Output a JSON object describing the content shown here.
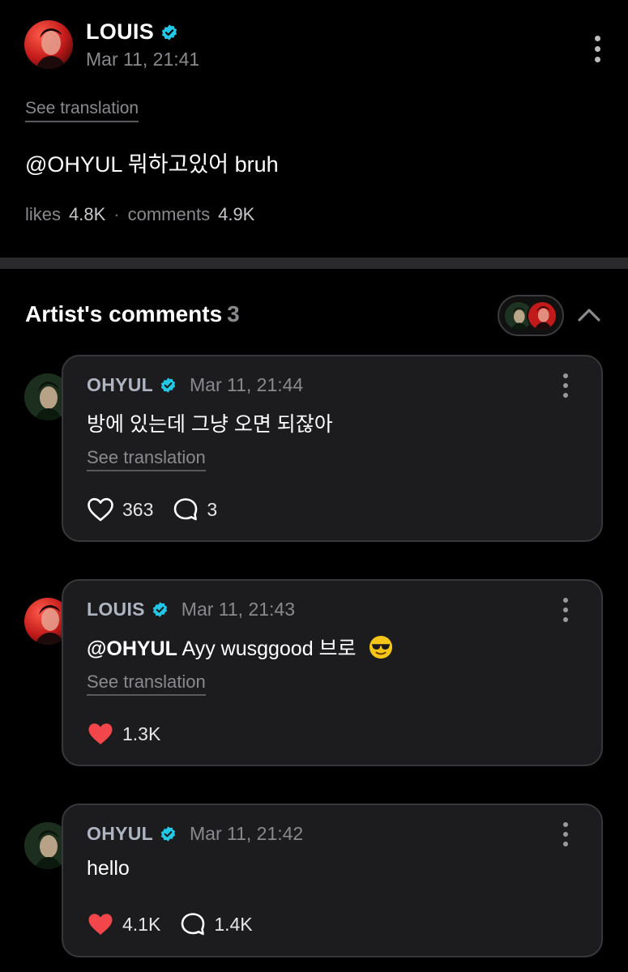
{
  "post": {
    "author": "LOUIS",
    "timestamp": "Mar 11, 21:41",
    "see_translation": "See translation",
    "text": "@OHYUL 뭐하고있어 bruh",
    "likes_label": "likes",
    "likes_value": "4.8K",
    "separator": "·",
    "comments_label": "comments",
    "comments_value": "4.9K"
  },
  "artist_comments": {
    "title": "Artist's comments",
    "count": "3",
    "comments": [
      {
        "author": "OHYUL",
        "timestamp": "Mar 11, 21:44",
        "text": "방에 있는데 그냥 오면 되잖아",
        "see_translation": "See translation",
        "likes": "363",
        "liked": false,
        "replies": "3"
      },
      {
        "author": "LOUIS",
        "timestamp": "Mar 11, 21:43",
        "mention": "@OHYUL",
        "text": "Ayy wusggood 브로",
        "emoji": "smiling-face-with-sunglasses",
        "see_translation": "See translation",
        "likes": "1.3K",
        "liked": true
      },
      {
        "author": "OHYUL",
        "timestamp": "Mar 11, 21:42",
        "text": "hello",
        "likes": "4.1K",
        "liked": true,
        "replies": "1.4K"
      }
    ]
  },
  "colors": {
    "background": "#000000",
    "card_background": "#1c1c1e",
    "verified_badge": "#23c8e6",
    "liked_heart": "#f2464b",
    "muted_text": "#8a8a8e"
  }
}
